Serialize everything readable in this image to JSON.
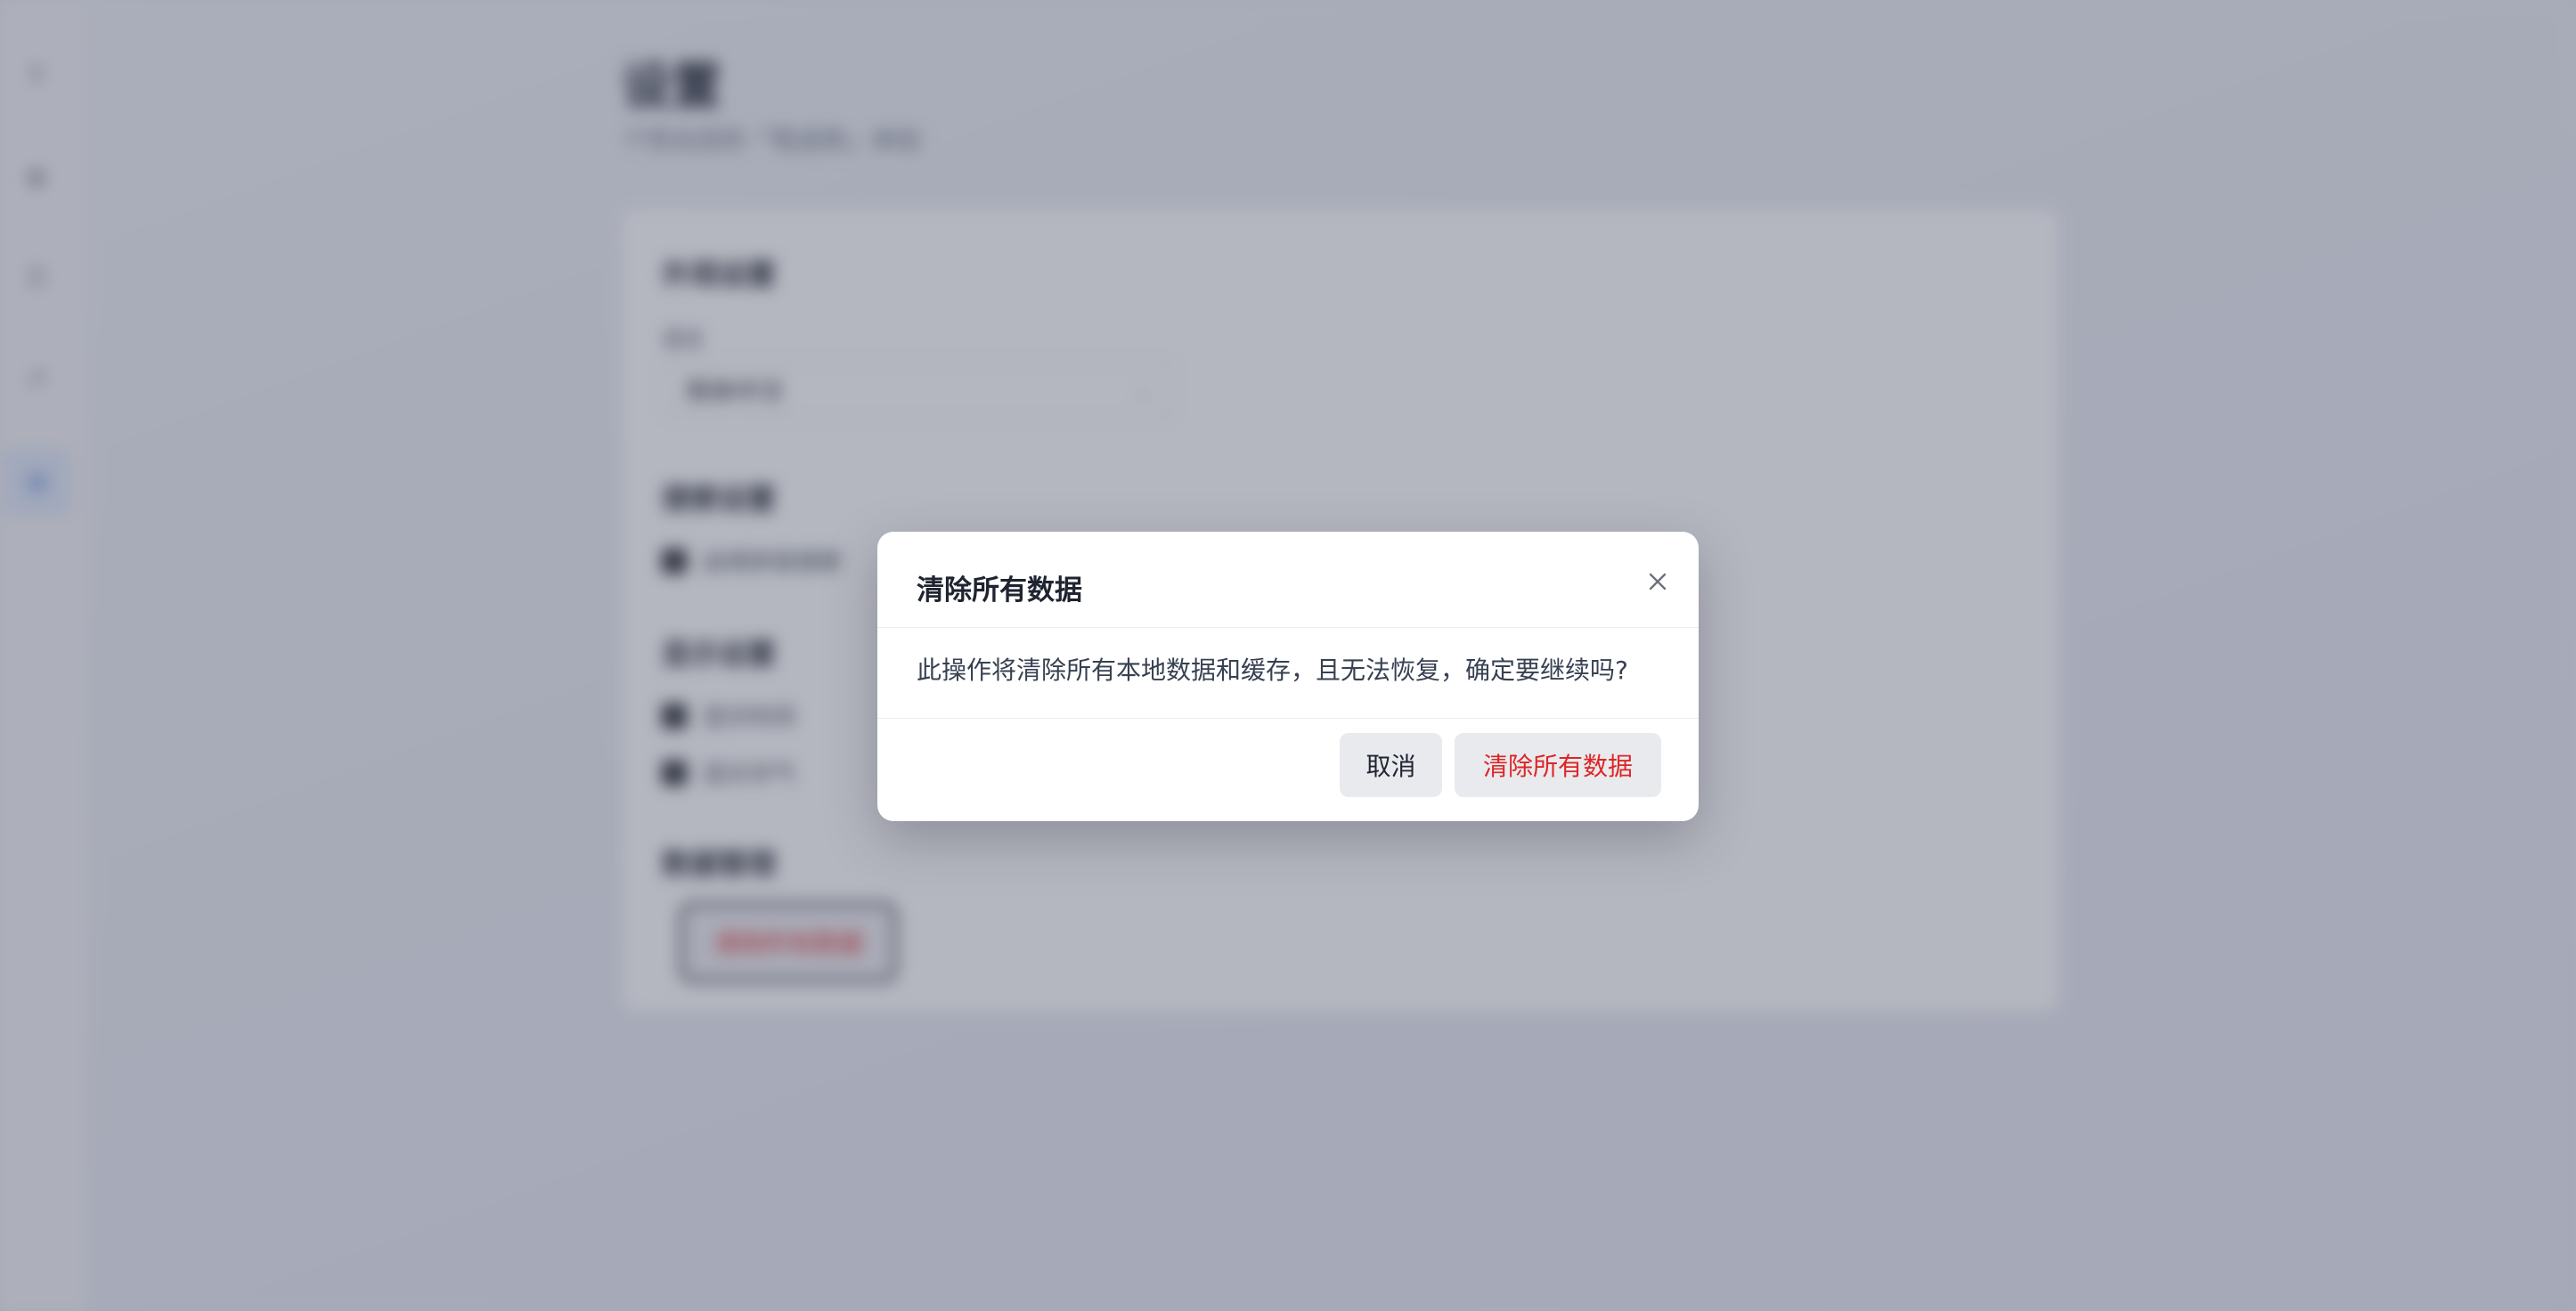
{
  "background_page": {
    "title": "设置",
    "subtitle": "个性化您的「笔迹库」体验",
    "sections": {
      "appearance": {
        "title": "外观设置",
        "language_label": "语言",
        "language_value": "简体中文"
      },
      "search": {
        "title": "搜索设置",
        "option": "启用拼音搜索"
      },
      "display": {
        "title": "显示设置",
        "option_1": "显示时间",
        "option_2": "显示天气"
      },
      "data": {
        "title": "数据管理",
        "clear_button": "清除所有数据"
      }
    },
    "sidebar_icons": [
      "search-icon",
      "compass-icon",
      "list-icon",
      "history-icon",
      "settings-icon"
    ]
  },
  "dialog": {
    "title": "清除所有数据",
    "message": "此操作将清除所有本地数据和缓存，且无法恢复，确定要继续吗?",
    "cancel_label": "取消",
    "confirm_label": "清除所有数据",
    "close_icon": "close-icon"
  },
  "colors": {
    "danger": "#dc2626",
    "accent": "#3b6fd8",
    "button_bg": "#e9eaee",
    "text_primary": "#1f2430"
  }
}
